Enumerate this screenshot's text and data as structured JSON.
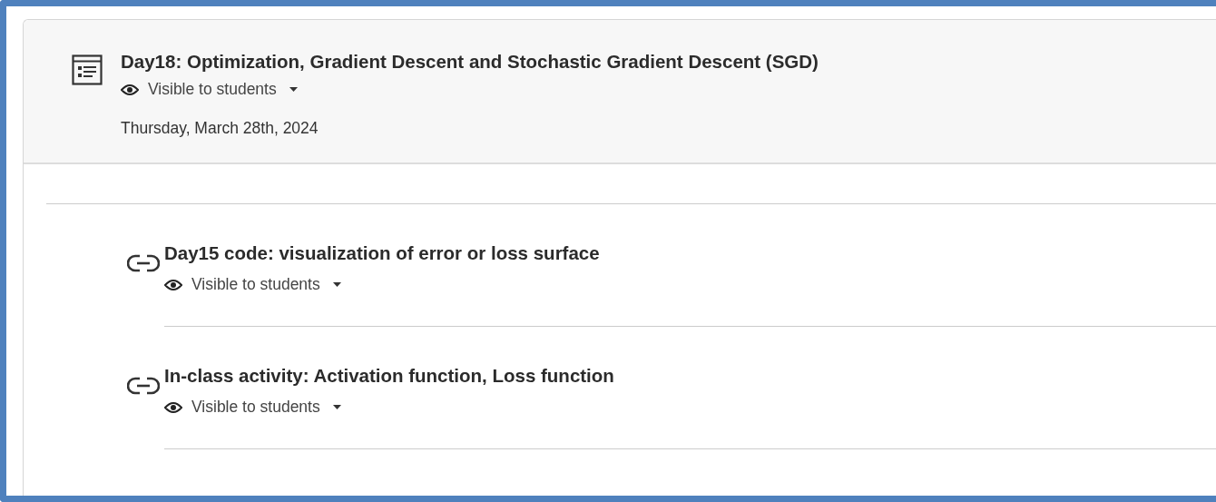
{
  "module": {
    "title": "Day18: Optimization, Gradient Descent and Stochastic Gradient Descent (SGD)",
    "visibility": "Visible to students",
    "date": "Thursday, March 28th, 2024"
  },
  "items": [
    {
      "kind": "link",
      "title": "Day15 code: visualization of error or loss surface",
      "visibility": "Visible to students"
    },
    {
      "kind": "link",
      "title": "In-class activity: Activation function, Loss function",
      "visibility": "Visible to students"
    }
  ]
}
